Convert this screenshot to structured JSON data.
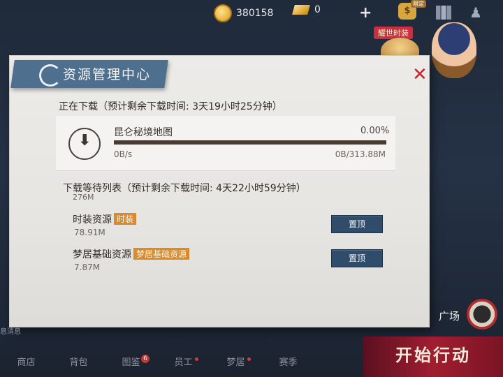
{
  "hud": {
    "coins": "380158",
    "gold": "0",
    "plus_icon": "plus",
    "promo_label": "耀世时装",
    "bag_badge": "限定"
  },
  "panel": {
    "title": "资源管理中心",
    "downloading_label": "正在下载（预计剩余下载时间: 3天19小时25分钟）",
    "current": {
      "name": "昆仑秘境地图",
      "percent": "0.00%",
      "progress_fraction": 0.0,
      "speed": "0B/s",
      "size": "0B/313.88M"
    },
    "queue_label": "下载等待列表（预计剩余下载时间: 4天22小时59分钟）",
    "queue_partial_size": "276M",
    "queue": [
      {
        "name": "时装资源",
        "tag": "时装",
        "size": "78.91M",
        "button": "置顶"
      },
      {
        "name": "梦居基础资源",
        "tag": "梦居基础资源",
        "size": "7.87M",
        "button": "置顶"
      }
    ]
  },
  "bottom": {
    "chat_hint": "息消息",
    "plaza": "广场",
    "nav": [
      {
        "label": "商店"
      },
      {
        "label": "背包"
      },
      {
        "label": "图鉴",
        "badge": "6"
      },
      {
        "label": "员工"
      },
      {
        "label": "梦居"
      },
      {
        "label": "赛季"
      }
    ],
    "start": "开始行动"
  },
  "colors": {
    "accent": "#4e6f8e",
    "progress": "#e08a2a",
    "tag": "#d9892e",
    "button": "#2f4d6a",
    "start": "#a01e30"
  }
}
